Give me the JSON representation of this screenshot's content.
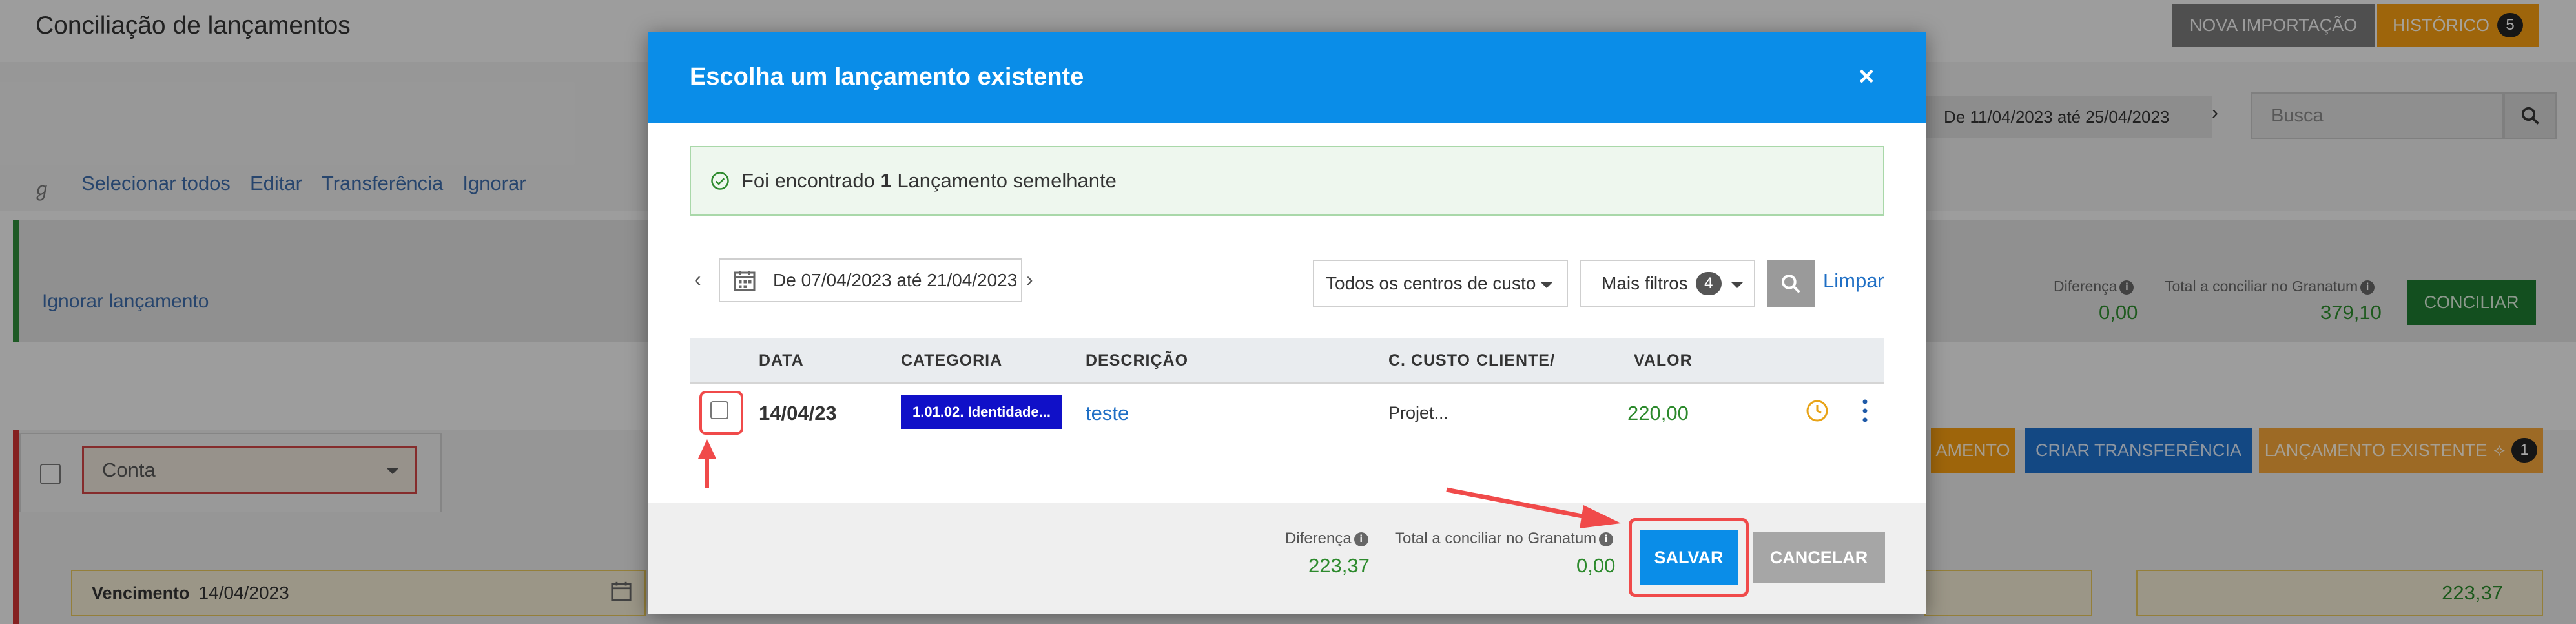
{
  "page": {
    "title": "Conciliação de lançamentos",
    "nova_importacao": "NOVA IMPORTAÇÃO",
    "historico": "HISTÓRICO",
    "historico_count": "5",
    "date_range": "De 11/04/2023 até 25/04/2023",
    "search_placeholder": "Busca",
    "actions": [
      "Selecionar todos",
      "Editar",
      "Transferência",
      "Ignorar"
    ],
    "ignorar_lancamento": "Ignorar lançamento",
    "diferenca_label": "Diferença",
    "diferenca_value": "0,00",
    "total_label": "Total a conciliar no Granatum",
    "total_value": "379,10",
    "conciliar": "CONCILIAR",
    "conta_placeholder": "Conta",
    "vencimento_label": "Vencimento",
    "vencimento_value": "14/04/2023",
    "orange_btn_partial": "AMENTO",
    "criar_transferencia": "CRIAR TRANSFERÊNCIA",
    "lancamento_existente": "LANÇAMENTO EXISTENTE",
    "lancamento_existente_count": "1",
    "right_value": "223,37"
  },
  "modal": {
    "title": "Escolha um lançamento existente",
    "close": "×",
    "alert_prefix": "Foi encontrado",
    "alert_count": "1",
    "alert_suffix": "Lançamento semelhante",
    "date_range": "De 07/04/2023 até 21/04/2023",
    "cost_center": "Todos os centros de custo",
    "more_filters": "Mais filtros",
    "more_filters_count": "4",
    "limpar": "Limpar",
    "columns": {
      "data": "DATA",
      "categoria": "CATEGORIA",
      "descricao": "DESCRIÇÃO",
      "c_custo": "C. CUSTO",
      "cliente": "CLIENTE/",
      "valor": "VALOR"
    },
    "rows": [
      {
        "date": "14/04/23",
        "category": "1.01.02. Identidade...",
        "description": "teste",
        "cost_center": "Projet...",
        "client": "",
        "value": "220,00"
      }
    ],
    "footer": {
      "diferenca_label": "Diferença",
      "diferenca_value": "223,37",
      "total_label": "Total a conciliar no Granatum",
      "total_value": "0,00",
      "salvar": "SALVAR",
      "cancelar": "CANCELAR"
    }
  },
  "colors": {
    "primary": "#0a8de8",
    "success": "#2d8a2d",
    "annotation": "#f04a4a",
    "category_badge": "#1010c8"
  }
}
